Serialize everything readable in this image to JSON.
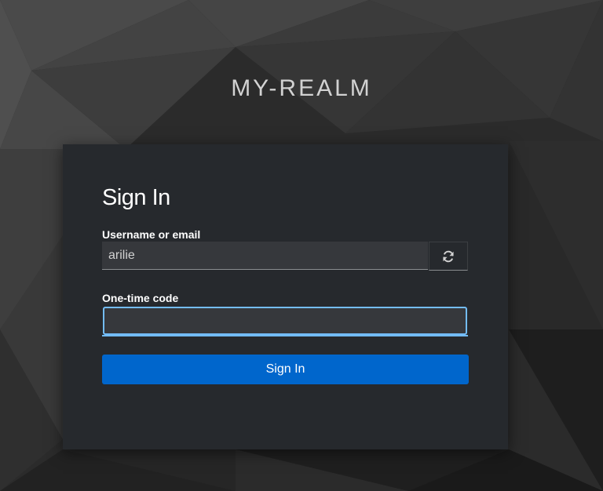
{
  "realm": {
    "title": "MY-REALM"
  },
  "login": {
    "heading": "Sign In",
    "username_label": "Username or email",
    "username_value": "arilie",
    "refresh_icon": "refresh-icon",
    "otp_label": "One-time code",
    "otp_value": "",
    "submit_label": "Sign In"
  },
  "colors": {
    "primary": "#0066cc",
    "focus": "#73bcf7",
    "card": "#26292d",
    "input": "#36383c"
  }
}
